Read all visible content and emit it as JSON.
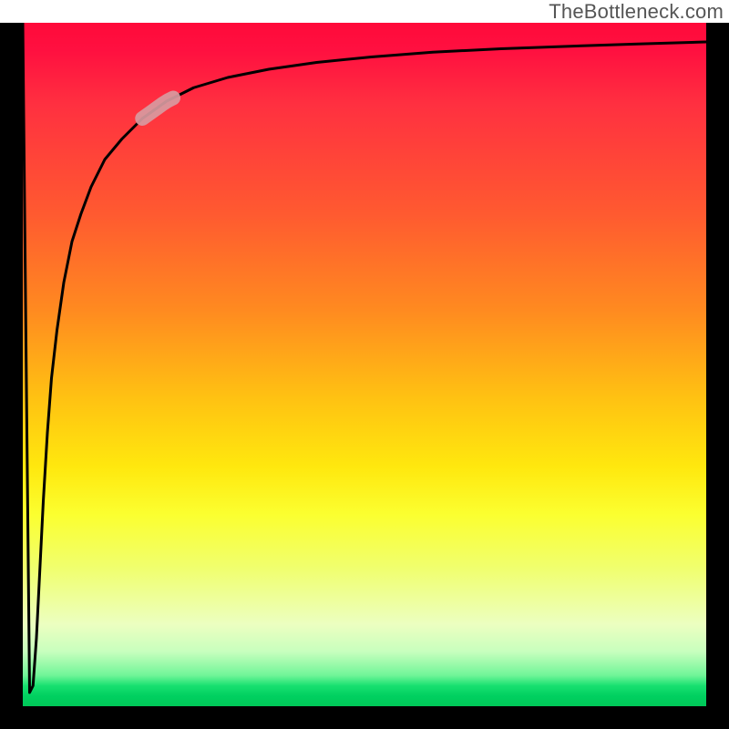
{
  "attribution": "TheBottleneck.com",
  "chart_data": {
    "type": "line",
    "title": "",
    "xlabel": "",
    "ylabel": "",
    "xlim": [
      0,
      100
    ],
    "ylim": [
      0,
      100
    ],
    "grid": false,
    "legend": false,
    "background": {
      "type": "vertical-gradient",
      "stops": [
        {
          "pos": 0,
          "color": "#ff0a3a"
        },
        {
          "pos": 28,
          "color": "#ff5a30"
        },
        {
          "pos": 55,
          "color": "#ffc212"
        },
        {
          "pos": 72,
          "color": "#fbff30"
        },
        {
          "pos": 88,
          "color": "#ecffc0"
        },
        {
          "pos": 97,
          "color": "#18e070"
        },
        {
          "pos": 100,
          "color": "#00c858"
        }
      ]
    },
    "series": [
      {
        "name": "bottleneck-curve",
        "color": "#000000",
        "x": [
          0.0,
          0.5,
          1.0,
          1.5,
          2.0,
          2.5,
          3.0,
          3.6,
          4.2,
          5.0,
          6.0,
          7.2,
          8.5,
          10.0,
          12.0,
          14.5,
          17.5,
          21.0,
          25.0,
          30.0,
          36.0,
          43.0,
          51.0,
          60.0,
          70.0,
          81.0,
          90.0,
          100.0
        ],
        "values": [
          100,
          50,
          2,
          3,
          10,
          20,
          30,
          40,
          48,
          55,
          62,
          68,
          72,
          76,
          80,
          83,
          86,
          88.5,
          90.5,
          92,
          93.2,
          94.2,
          95,
          95.7,
          96.2,
          96.6,
          96.9,
          97.2
        ]
      }
    ],
    "highlight_segment": {
      "series": "bottleneck-curve",
      "x_range": [
        17.5,
        22.0
      ],
      "color": "#d89a9f",
      "note": "pale capsule marker on curve"
    }
  }
}
